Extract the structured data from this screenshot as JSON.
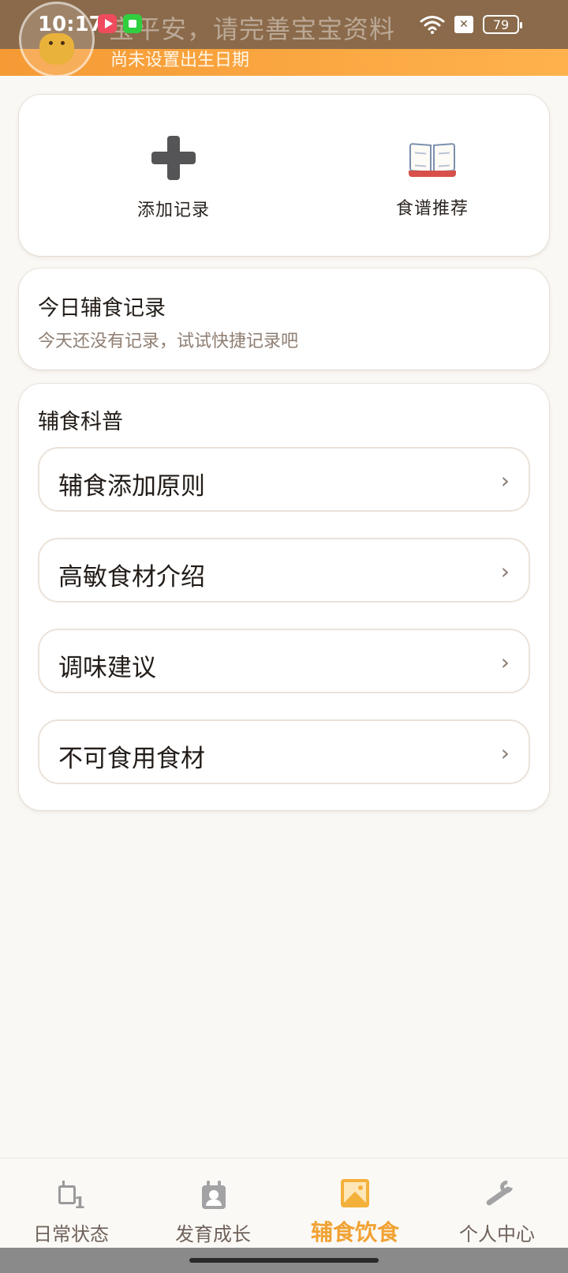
{
  "status_bar": {
    "time": "10:17",
    "battery": "79",
    "sim_label": "✕",
    "icons": [
      "video-app-icon",
      "green-app-icon",
      "wifi-icon",
      "sim-off-icon",
      "battery-icon"
    ]
  },
  "header": {
    "greeting": "宝平安，请完善宝宝资料",
    "subtitle": "尚未设置出生日期",
    "avatar_icon": "baby-avatar-icon",
    "accent_color": "#f6a640"
  },
  "quick_actions": [
    {
      "label": "添加记录",
      "icon": "plus-icon"
    },
    {
      "label": "食谱推荐",
      "icon": "book-icon"
    }
  ],
  "today_record": {
    "title": "今日辅食记录",
    "empty_text": "今天还没有记录，试试快捷记录吧"
  },
  "science": {
    "title": "辅食科普",
    "items": [
      {
        "label": "辅食添加原则",
        "chevron": "›"
      },
      {
        "label": "高敏食材介绍",
        "chevron": "›"
      },
      {
        "label": "调味建议",
        "chevron": "›"
      },
      {
        "label": "不可食用食材",
        "chevron": "›"
      }
    ]
  },
  "bottom_nav": {
    "active_index": 2,
    "active_color": "#f0a233",
    "items": [
      {
        "label": "日常状态",
        "icon": "calendar-icon"
      },
      {
        "label": "发育成长",
        "icon": "growth-calendar-icon"
      },
      {
        "label": "辅食饮食",
        "icon": "picture-icon"
      },
      {
        "label": "个人中心",
        "icon": "wrench-icon"
      }
    ]
  }
}
